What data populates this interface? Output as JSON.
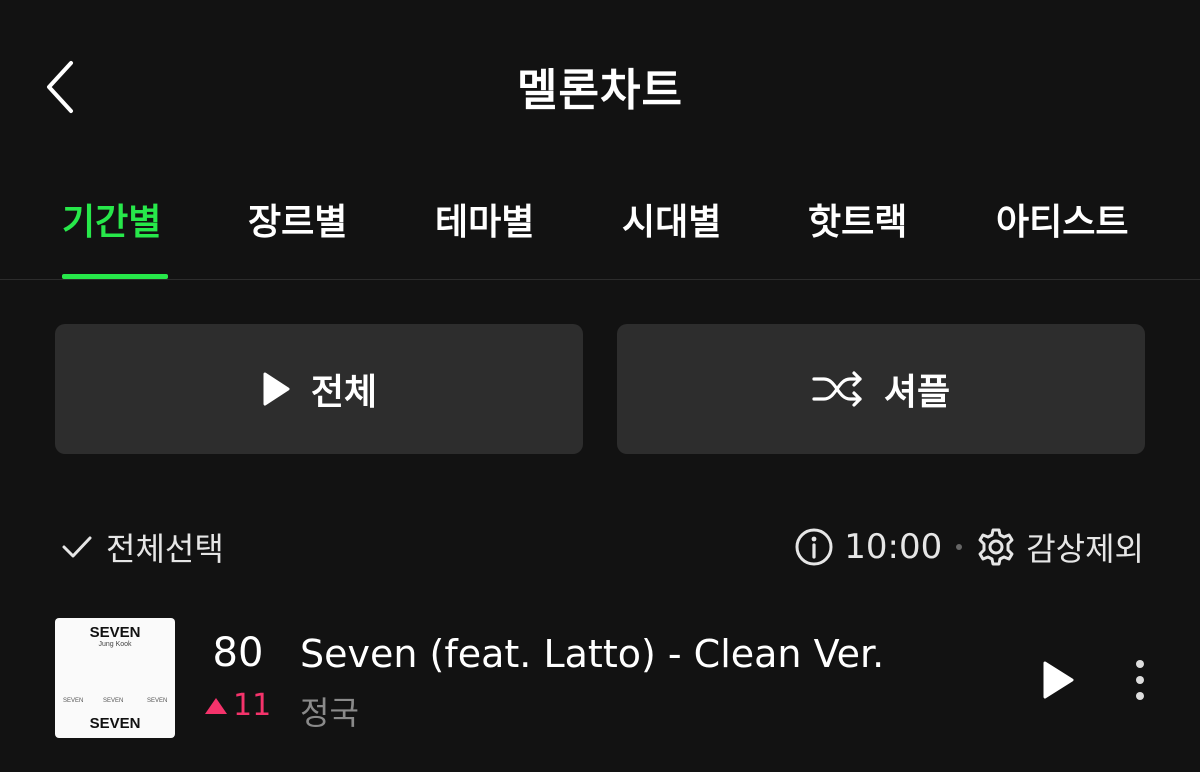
{
  "header": {
    "title": "멜론차트",
    "back_icon": "chevron-left-icon"
  },
  "tabs": [
    {
      "label": "기간별",
      "active": true
    },
    {
      "label": "장르별",
      "active": false
    },
    {
      "label": "테마별",
      "active": false
    },
    {
      "label": "시대별",
      "active": false
    },
    {
      "label": "핫트랙",
      "active": false
    },
    {
      "label": "아티스트",
      "active": false
    }
  ],
  "actions": {
    "play_all_label": "전체",
    "shuffle_label": "셔플"
  },
  "toolbar": {
    "select_all_label": "전체선택",
    "time": "10:00",
    "exclude_label": "감상제외"
  },
  "song": {
    "rank": "80",
    "rank_change": "11",
    "rank_direction": "up",
    "title": "Seven (feat. Latto) - Clean Ver.",
    "artist": "정국",
    "album_art_text": {
      "top": "SEVEN",
      "sub": "Jung Kook",
      "bottom": "SEVEN"
    }
  },
  "colors": {
    "accent": "#27e84a",
    "rank_up": "#f5336b",
    "background": "#121212",
    "button_bg": "#2d2d2d"
  }
}
